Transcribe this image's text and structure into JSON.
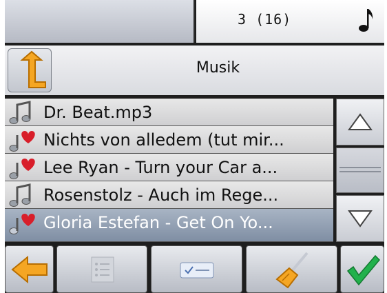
{
  "status": {
    "track_counter": "3 (16)",
    "mode_icon": "music-note-icon"
  },
  "header": {
    "folder_title": "Musik",
    "up_icon": "folder-up-arrow-icon"
  },
  "playlist": {
    "items": [
      {
        "label": "Dr. Beat.mp3",
        "icon": "music-note-icon",
        "selected": false
      },
      {
        "label": "Nichts von alledem (tut mir...",
        "icon": "favorite-music-icon",
        "selected": false
      },
      {
        "label": "Lee Ryan - Turn your Car a...",
        "icon": "favorite-music-icon",
        "selected": false
      },
      {
        "label": "Rosenstolz - Auch im Rege...",
        "icon": "music-note-icon",
        "selected": false
      },
      {
        "label": "Gloria Estefan - Get On Yo...",
        "icon": "favorite-music-icon",
        "selected": true
      }
    ]
  },
  "scrollbar": {
    "up_icon": "triangle-up-icon",
    "down_icon": "triangle-down-icon"
  },
  "toolbar": {
    "back_icon": "arrow-left-icon",
    "list_icon": "checklist-icon",
    "select_icon": "select-all-icon",
    "clear_icon": "broom-icon",
    "confirm_icon": "checkmark-icon"
  },
  "colors": {
    "accent_orange": "#f5a623",
    "heart_red": "#d81e2a",
    "confirm_green": "#22b14c",
    "selection_blue": "#8796ab"
  }
}
